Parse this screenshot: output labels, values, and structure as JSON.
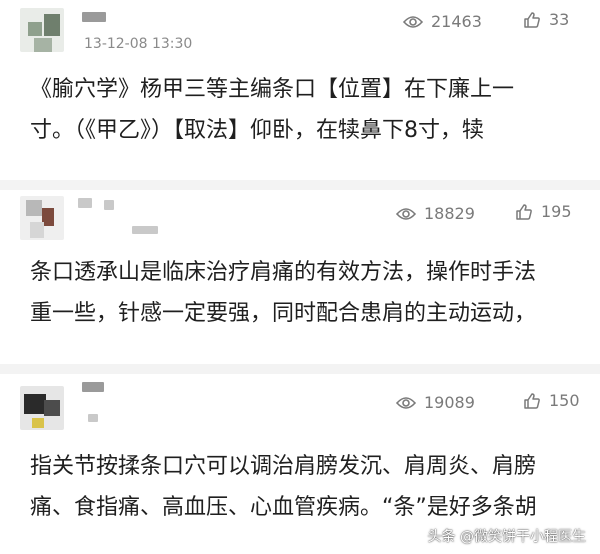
{
  "comments": [
    {
      "timestamp": "13-12-08 13:30",
      "views": "21463",
      "likes": "33",
      "lines": [
        "《腧穴学》杨甲三等主编条口【位置】在下廉上一",
        "寸。（《甲乙》）【取法】仰卧，在犊鼻下8寸，犊"
      ]
    },
    {
      "views": "18829",
      "likes": "195",
      "lines": [
        "条口透承山是临床治疗肩痛的有效方法，操作时手法",
        "重一些，针感一定要强，同时配合患肩的主动运动，"
      ]
    },
    {
      "views": "19089",
      "likes": "150",
      "lines": [
        "指关节按揉条口穴可以调治肩膀发沉、肩周炎、肩膀",
        "痛、食指痛、高血压、心血管疾病。“条”是好多条胡"
      ]
    }
  ],
  "watermark": "头条 @微笑饼干小程医生",
  "icons": {
    "views": "eye-icon",
    "likes": "thumbs-up-icon"
  },
  "colors": {
    "text": "#1f1f1f",
    "meta": "#7a7a7a",
    "divider": "#f3f3f3"
  }
}
